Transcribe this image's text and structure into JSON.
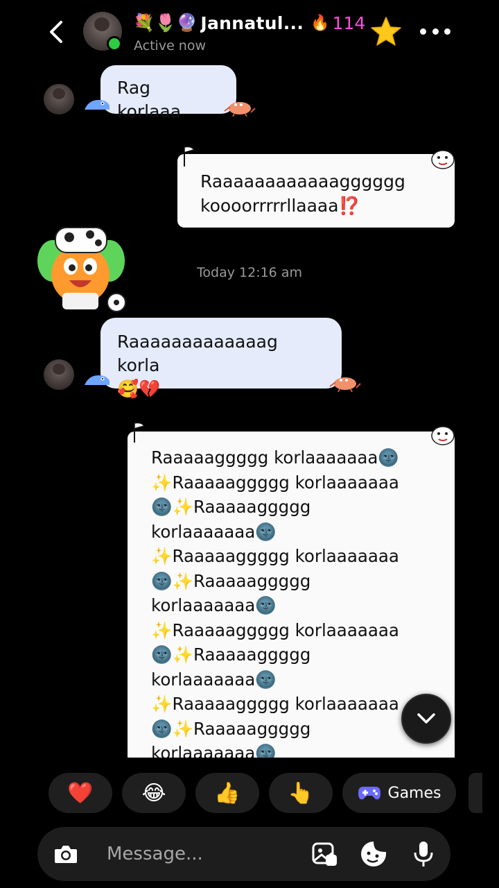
{
  "header": {
    "name_emoji": "💐🌷🔮",
    "name": "Jannatul...",
    "streak_count": "114",
    "status": "Active now"
  },
  "messages": {
    "m1": "Rag korlaaa",
    "m2_line1": "Raaaaaaaaaaaagggggg",
    "m2_line2": "koooorrrrrllaaaa⁉️",
    "timestamp": "Today 12:16 am",
    "m3_line1": "Raaaaaaaaaaaaag korla",
    "m3_line2": "🥰💔",
    "m4_lines": [
      "Raaaaaggggg korlaaaaaaa🌚",
      "✨Raaaaaggggg korlaaaaaaa",
      "🌚✨Raaaaaggggg",
      "korlaaaaaaa🌚",
      "✨Raaaaaggggg korlaaaaaaa",
      "🌚✨Raaaaaggggg",
      "korlaaaaaaa🌚",
      "✨Raaaaaggggg korlaaaaaaa",
      "🌚✨Raaaaaggggg",
      "korlaaaaaaa🌚",
      "✨Raaaaaggggg korlaaaaaaa",
      "🌚✨Raaaaaggggg",
      "korlaaaaaaa🌚"
    ]
  },
  "quick_reactions": [
    "❤️",
    "😂",
    "👍",
    "👆"
  ],
  "games_label": "Games",
  "composer": {
    "placeholder": "Message..."
  },
  "colors": {
    "background": "#000000",
    "bubble_incoming": "#e5ebfb",
    "bubble_outgoing": "#fafafa",
    "streak": "#ff4fd8",
    "online": "#2ecc40",
    "games_icon": "#6b6bff"
  }
}
